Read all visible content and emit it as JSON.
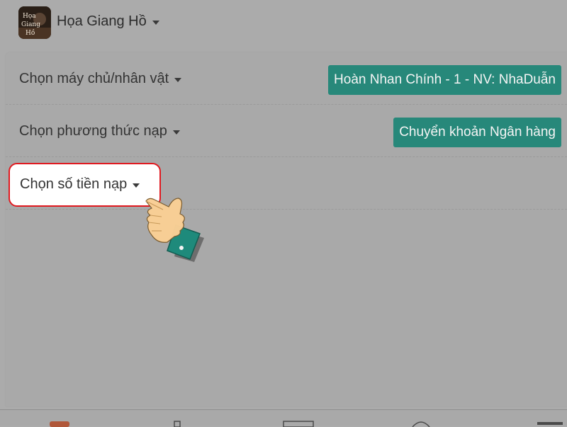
{
  "header": {
    "title": "Họa Giang Hồ",
    "logo_text": "Họa Giang Hồ"
  },
  "form": {
    "server_label": "Chọn máy chủ/nhân vật",
    "server_value": "Hoàn Nhan Chính - 1 - NV: NhaDuẫn",
    "method_label": "Chọn phương thức nạp",
    "method_value": "Chuyển khoản Ngân hàng",
    "amount_label": "Chọn số tiền nạp"
  },
  "icons": {
    "pointer": "pointing-hand-icon",
    "caret": "caret-down-icon"
  },
  "colors": {
    "accent": "#27887a",
    "highlight_border": "#e0191f",
    "overlay_bg": "#ababab"
  }
}
